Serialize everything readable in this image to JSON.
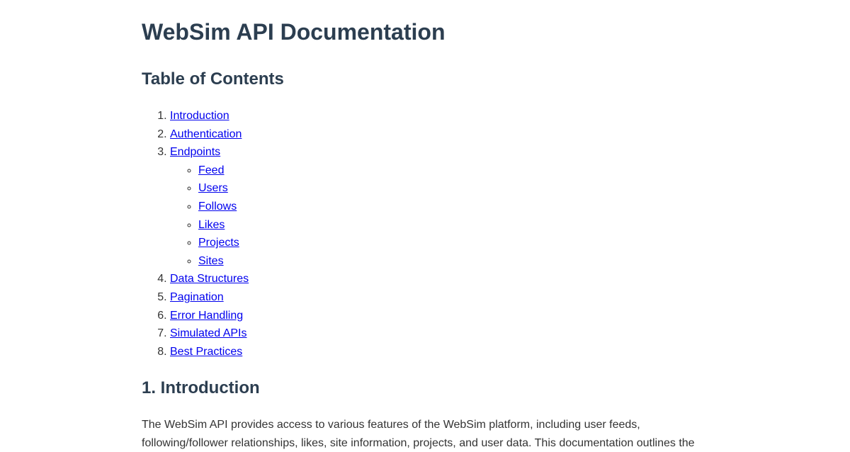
{
  "page": {
    "title": "WebSim API Documentation"
  },
  "toc": {
    "heading": "Table of Contents",
    "items": [
      {
        "label": "Introduction"
      },
      {
        "label": "Authentication"
      },
      {
        "label": "Endpoints",
        "children": [
          "Feed",
          "Users",
          "Follows",
          "Likes",
          "Projects",
          "Sites"
        ]
      },
      {
        "label": "Data Structures"
      },
      {
        "label": "Pagination"
      },
      {
        "label": "Error Handling"
      },
      {
        "label": "Simulated APIs"
      },
      {
        "label": "Best Practices"
      }
    ]
  },
  "introduction": {
    "heading": "1. Introduction",
    "body": "The WebSim API provides access to various features of the WebSim platform, including user feeds, following/follower relationships, likes, site information, projects, and user data. This documentation outlines the"
  }
}
